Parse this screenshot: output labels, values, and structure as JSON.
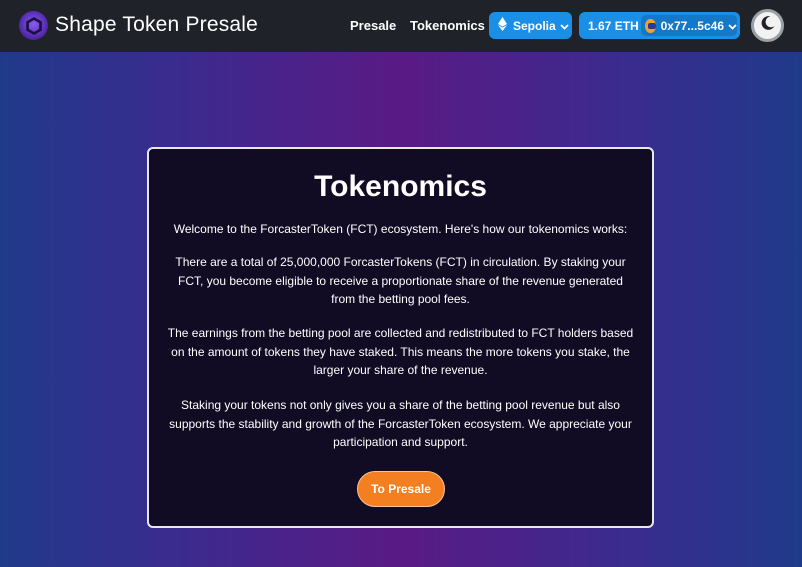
{
  "navbar": {
    "brand_title": "Shape Token Presale",
    "logo_icon": "hexagon-logo-icon",
    "links": [
      {
        "label": "Presale"
      },
      {
        "label": "Tokenomics"
      }
    ],
    "network": {
      "label": "Sepolia",
      "icon": "ethereum-icon"
    },
    "account": {
      "balance": "1.67 ETH",
      "address": "0x77...5c46",
      "avatar_icon": "wallet-avatar-icon"
    },
    "theme_toggle_icon": "moon-icon"
  },
  "main": {
    "title": "Tokenomics",
    "paragraphs": [
      "Welcome to the ForcasterToken (FCT) ecosystem. Here's how our tokenomics works:",
      "There are a total of 25,000,000 ForcasterTokens (FCT) in circulation. By staking your FCT, you become eligible to receive a proportionate share of the revenue generated from the betting pool fees.",
      "The earnings from the betting pool are collected and redistributed to FCT holders based on the amount of tokens they have staked. This means the more tokens you stake, the larger your share of the revenue.",
      "Staking your tokens not only gives you a share of the betting pool revenue but also supports the stability and growth of the ForcasterToken ecosystem. We appreciate your participation and support."
    ],
    "cta_label": "To Presale"
  },
  "colors": {
    "navbar_bg": "#1f2228",
    "accent_blue": "#1a8fe8",
    "cta_orange": "#f37f20",
    "card_bg": "#110c24"
  }
}
